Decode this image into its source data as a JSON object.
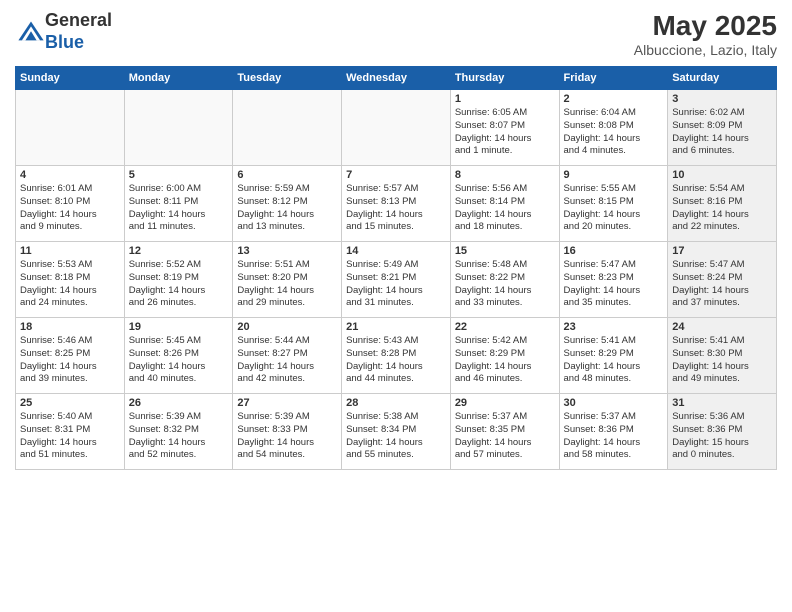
{
  "header": {
    "logo_general": "General",
    "logo_blue": "Blue",
    "main_title": "May 2025",
    "subtitle": "Albuccione, Lazio, Italy"
  },
  "days_of_week": [
    "Sunday",
    "Monday",
    "Tuesday",
    "Wednesday",
    "Thursday",
    "Friday",
    "Saturday"
  ],
  "weeks": [
    [
      {
        "day": "",
        "info": "",
        "empty": true
      },
      {
        "day": "",
        "info": "",
        "empty": true
      },
      {
        "day": "",
        "info": "",
        "empty": true
      },
      {
        "day": "",
        "info": "",
        "empty": true
      },
      {
        "day": "1",
        "info": "Sunrise: 6:05 AM\nSunset: 8:07 PM\nDaylight: 14 hours\nand 1 minute."
      },
      {
        "day": "2",
        "info": "Sunrise: 6:04 AM\nSunset: 8:08 PM\nDaylight: 14 hours\nand 4 minutes."
      },
      {
        "day": "3",
        "info": "Sunrise: 6:02 AM\nSunset: 8:09 PM\nDaylight: 14 hours\nand 6 minutes.",
        "shaded": true
      }
    ],
    [
      {
        "day": "4",
        "info": "Sunrise: 6:01 AM\nSunset: 8:10 PM\nDaylight: 14 hours\nand 9 minutes."
      },
      {
        "day": "5",
        "info": "Sunrise: 6:00 AM\nSunset: 8:11 PM\nDaylight: 14 hours\nand 11 minutes."
      },
      {
        "day": "6",
        "info": "Sunrise: 5:59 AM\nSunset: 8:12 PM\nDaylight: 14 hours\nand 13 minutes."
      },
      {
        "day": "7",
        "info": "Sunrise: 5:57 AM\nSunset: 8:13 PM\nDaylight: 14 hours\nand 15 minutes."
      },
      {
        "day": "8",
        "info": "Sunrise: 5:56 AM\nSunset: 8:14 PM\nDaylight: 14 hours\nand 18 minutes."
      },
      {
        "day": "9",
        "info": "Sunrise: 5:55 AM\nSunset: 8:15 PM\nDaylight: 14 hours\nand 20 minutes."
      },
      {
        "day": "10",
        "info": "Sunrise: 5:54 AM\nSunset: 8:16 PM\nDaylight: 14 hours\nand 22 minutes.",
        "shaded": true
      }
    ],
    [
      {
        "day": "11",
        "info": "Sunrise: 5:53 AM\nSunset: 8:18 PM\nDaylight: 14 hours\nand 24 minutes."
      },
      {
        "day": "12",
        "info": "Sunrise: 5:52 AM\nSunset: 8:19 PM\nDaylight: 14 hours\nand 26 minutes."
      },
      {
        "day": "13",
        "info": "Sunrise: 5:51 AM\nSunset: 8:20 PM\nDaylight: 14 hours\nand 29 minutes."
      },
      {
        "day": "14",
        "info": "Sunrise: 5:49 AM\nSunset: 8:21 PM\nDaylight: 14 hours\nand 31 minutes."
      },
      {
        "day": "15",
        "info": "Sunrise: 5:48 AM\nSunset: 8:22 PM\nDaylight: 14 hours\nand 33 minutes."
      },
      {
        "day": "16",
        "info": "Sunrise: 5:47 AM\nSunset: 8:23 PM\nDaylight: 14 hours\nand 35 minutes."
      },
      {
        "day": "17",
        "info": "Sunrise: 5:47 AM\nSunset: 8:24 PM\nDaylight: 14 hours\nand 37 minutes.",
        "shaded": true
      }
    ],
    [
      {
        "day": "18",
        "info": "Sunrise: 5:46 AM\nSunset: 8:25 PM\nDaylight: 14 hours\nand 39 minutes."
      },
      {
        "day": "19",
        "info": "Sunrise: 5:45 AM\nSunset: 8:26 PM\nDaylight: 14 hours\nand 40 minutes."
      },
      {
        "day": "20",
        "info": "Sunrise: 5:44 AM\nSunset: 8:27 PM\nDaylight: 14 hours\nand 42 minutes."
      },
      {
        "day": "21",
        "info": "Sunrise: 5:43 AM\nSunset: 8:28 PM\nDaylight: 14 hours\nand 44 minutes."
      },
      {
        "day": "22",
        "info": "Sunrise: 5:42 AM\nSunset: 8:29 PM\nDaylight: 14 hours\nand 46 minutes."
      },
      {
        "day": "23",
        "info": "Sunrise: 5:41 AM\nSunset: 8:29 PM\nDaylight: 14 hours\nand 48 minutes."
      },
      {
        "day": "24",
        "info": "Sunrise: 5:41 AM\nSunset: 8:30 PM\nDaylight: 14 hours\nand 49 minutes.",
        "shaded": true
      }
    ],
    [
      {
        "day": "25",
        "info": "Sunrise: 5:40 AM\nSunset: 8:31 PM\nDaylight: 14 hours\nand 51 minutes."
      },
      {
        "day": "26",
        "info": "Sunrise: 5:39 AM\nSunset: 8:32 PM\nDaylight: 14 hours\nand 52 minutes."
      },
      {
        "day": "27",
        "info": "Sunrise: 5:39 AM\nSunset: 8:33 PM\nDaylight: 14 hours\nand 54 minutes."
      },
      {
        "day": "28",
        "info": "Sunrise: 5:38 AM\nSunset: 8:34 PM\nDaylight: 14 hours\nand 55 minutes."
      },
      {
        "day": "29",
        "info": "Sunrise: 5:37 AM\nSunset: 8:35 PM\nDaylight: 14 hours\nand 57 minutes."
      },
      {
        "day": "30",
        "info": "Sunrise: 5:37 AM\nSunset: 8:36 PM\nDaylight: 14 hours\nand 58 minutes."
      },
      {
        "day": "31",
        "info": "Sunrise: 5:36 AM\nSunset: 8:36 PM\nDaylight: 15 hours\nand 0 minutes.",
        "shaded": true
      }
    ]
  ]
}
